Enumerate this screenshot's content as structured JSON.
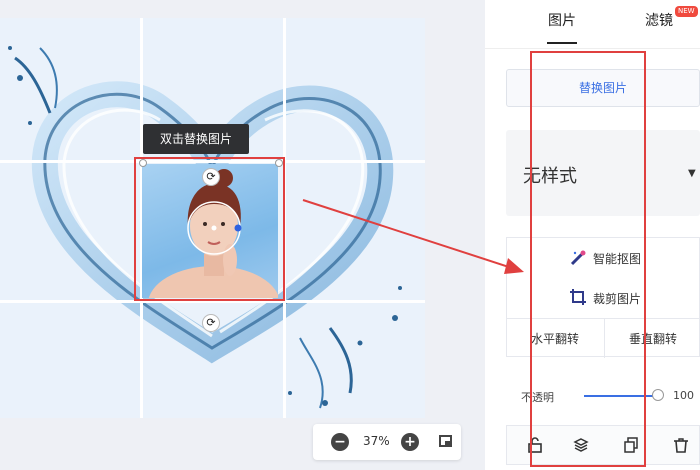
{
  "canvas": {
    "tooltip": "双击替换图片",
    "rotate_icon": "rotate-icon",
    "accent_color": "#e0403f"
  },
  "zoom": {
    "minus_symbol": "−",
    "value": "37%",
    "plus_symbol": "+",
    "fit_icon": "fit-screen-icon"
  },
  "panel": {
    "tabs": [
      {
        "label": "图片",
        "active": true
      },
      {
        "label": "滤镜",
        "active": false
      }
    ],
    "new_badge": "NEW",
    "replace_button": "替换图片",
    "style_select": "无样式",
    "tools": {
      "smart_cutout": "智能抠图",
      "crop": "裁剪图片",
      "flip_h": "水平翻转",
      "flip_v": "垂直翻转"
    },
    "opacity": {
      "label": "不透明",
      "value": "100",
      "level": 1.0
    },
    "bottom_icons": [
      "unlock-icon",
      "layers-icon",
      "copy-icon",
      "delete-icon"
    ],
    "link_color": "#3a6fe3"
  }
}
